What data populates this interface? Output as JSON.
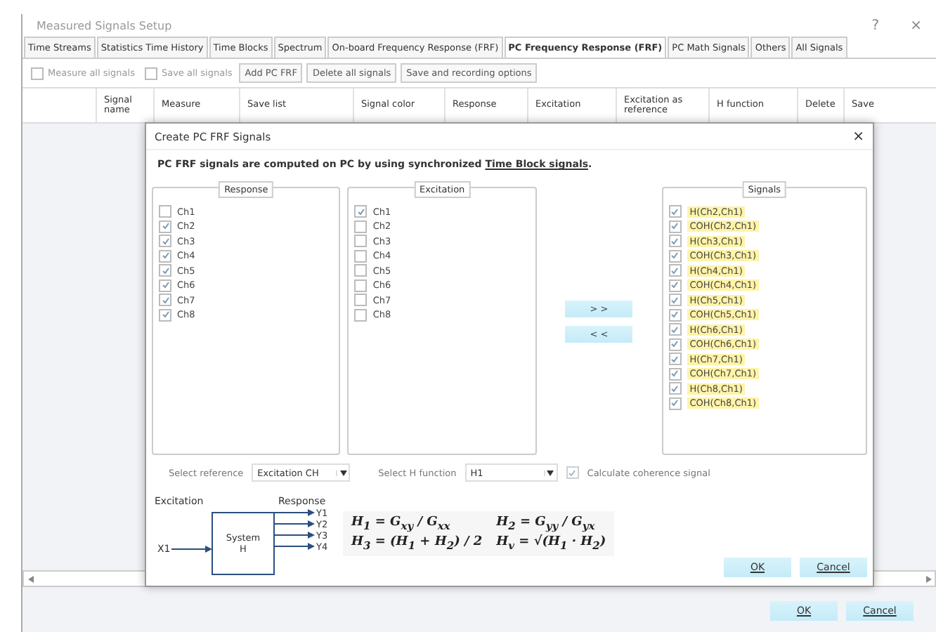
{
  "window": {
    "title": "Measured Signals Setup",
    "help": "?",
    "close": "×"
  },
  "tabs": [
    {
      "label": "Time Streams",
      "selected": false
    },
    {
      "label": "Statistics Time History",
      "selected": false
    },
    {
      "label": "Time Blocks",
      "selected": false
    },
    {
      "label": "Spectrum",
      "selected": false
    },
    {
      "label": "On-board Frequency Response (FRF)",
      "selected": false
    },
    {
      "label": "PC Frequency Response (FRF)",
      "selected": true
    },
    {
      "label": "PC Math Signals",
      "selected": false
    },
    {
      "label": "Others",
      "selected": false
    },
    {
      "label": "All Signals",
      "selected": false
    }
  ],
  "toolbar": [
    {
      "kind": "checkbox",
      "label": "Measure all signals",
      "checked": false
    },
    {
      "kind": "checkbox",
      "label": "Save all signals",
      "checked": false
    },
    {
      "kind": "button",
      "label": "Add PC FRF"
    },
    {
      "kind": "button",
      "label": "Delete all signals"
    },
    {
      "kind": "button",
      "label": "Save and recording options"
    }
  ],
  "table": {
    "columns": [
      "Signal name",
      "Measure",
      "Save list",
      "Signal color",
      "Response",
      "Excitation",
      "Excitation as reference",
      "H function",
      "Delete",
      "Save"
    ]
  },
  "dialog": {
    "title": "Create PC FRF Signals",
    "close": "×",
    "info": {
      "text": "PC FRF signals are computed on PC by using synchronized",
      "link": "Time Block signals",
      "end": "."
    },
    "response": {
      "title": "Response",
      "items": [
        {
          "label": "Ch1",
          "checked": false
        },
        {
          "label": "Ch2",
          "checked": true
        },
        {
          "label": "Ch3",
          "checked": true
        },
        {
          "label": "Ch4",
          "checked": true
        },
        {
          "label": "Ch5",
          "checked": true
        },
        {
          "label": "Ch6",
          "checked": true
        },
        {
          "label": "Ch7",
          "checked": true
        },
        {
          "label": "Ch8",
          "checked": true
        }
      ]
    },
    "excitation": {
      "title": "Excitation",
      "items": [
        {
          "label": "Ch1",
          "checked": true
        },
        {
          "label": "Ch2",
          "checked": false
        },
        {
          "label": "Ch3",
          "checked": false
        },
        {
          "label": "Ch4",
          "checked": false
        },
        {
          "label": "Ch5",
          "checked": false
        },
        {
          "label": "Ch6",
          "checked": false
        },
        {
          "label": "Ch7",
          "checked": false
        },
        {
          "label": "Ch8",
          "checked": false
        }
      ]
    },
    "move_buttons": [
      "> >",
      "< <"
    ],
    "signals": {
      "title": "Signals",
      "items": [
        {
          "label": "H(Ch2,Ch1)",
          "checked": true
        },
        {
          "label": "COH(Ch2,Ch1)",
          "checked": true
        },
        {
          "label": "H(Ch3,Ch1)",
          "checked": true
        },
        {
          "label": "COH(Ch3,Ch1)",
          "checked": true
        },
        {
          "label": "H(Ch4,Ch1)",
          "checked": true
        },
        {
          "label": "COH(Ch4,Ch1)",
          "checked": true
        },
        {
          "label": "H(Ch5,Ch1)",
          "checked": true
        },
        {
          "label": "COH(Ch5,Ch1)",
          "checked": true
        },
        {
          "label": "H(Ch6,Ch1)",
          "checked": true
        },
        {
          "label": "COH(Ch6,Ch1)",
          "checked": true
        },
        {
          "label": "H(Ch7,Ch1)",
          "checked": true
        },
        {
          "label": "COH(Ch7,Ch1)",
          "checked": true
        },
        {
          "label": "H(Ch8,Ch1)",
          "checked": true
        },
        {
          "label": "COH(Ch8,Ch1)",
          "checked": true
        }
      ]
    },
    "reference": {
      "label": "Select reference",
      "value": "Excitation CH"
    },
    "h_function": {
      "label": "Select H function",
      "value": "H1"
    },
    "coherence": {
      "label": "Calculate coherence signal",
      "checked": true
    },
    "diagram": {
      "input_label": "Excitation",
      "output_label": "Response",
      "input": "X1",
      "system": [
        "System",
        "H"
      ],
      "outputs": [
        "Y1",
        "Y2",
        "Y3",
        "Y4"
      ]
    },
    "formulas": [
      "H$_{1}$ = G$_{xy}$ / G$_{xx}$",
      "H$_{2}$ = G$_{yy}$ / G$_{yx}$",
      "H$_{3}$ = (H$_{1}$ + H$_{2}$) / 2",
      "H$_{v}$ = √(H$_{1}$ · H$_{2}$)"
    ],
    "buttons": [
      "OK",
      "Cancel"
    ]
  },
  "buttons": [
    "OK",
    "Cancel"
  ]
}
